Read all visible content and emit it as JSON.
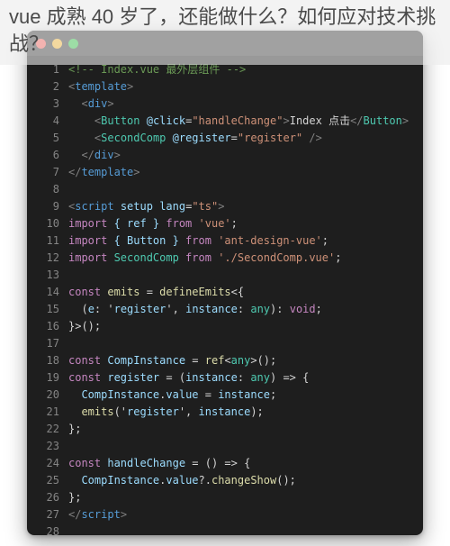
{
  "heading": "vue 成熟 40 岁了，还能做什么？如何应对技术挑战？",
  "editor": {
    "window_buttons": [
      "close",
      "minimize",
      "zoom"
    ],
    "code_lines": [
      {
        "n": 1,
        "kind": "comment",
        "text": "<!-- Index.vue 最外层组件 -->"
      },
      {
        "n": 2,
        "kind": "tag-open",
        "tag": "template"
      },
      {
        "n": 3,
        "kind": "tag-open",
        "tag": "div",
        "indent": 1
      },
      {
        "n": 4,
        "kind": "element",
        "indent": 2,
        "tag": "Button",
        "attr": "@click",
        "attrValue": "handleChange",
        "inner": "Index 点击"
      },
      {
        "n": 5,
        "kind": "element-self",
        "indent": 2,
        "tag": "SecondComp",
        "attr": "@register",
        "attrValue": "register"
      },
      {
        "n": 6,
        "kind": "tag-close",
        "tag": "div",
        "indent": 1
      },
      {
        "n": 7,
        "kind": "tag-close",
        "tag": "template"
      },
      {
        "n": 8,
        "kind": "blank"
      },
      {
        "n": 9,
        "kind": "tag-open-attrs",
        "tag": "script",
        "attrs": [
          [
            "setup",
            ""
          ],
          [
            "lang",
            "ts"
          ]
        ]
      },
      {
        "n": 10,
        "kind": "import",
        "names": "{ ref }",
        "from": "vue"
      },
      {
        "n": 11,
        "kind": "import",
        "names": "{ Button }",
        "from": "ant-design-vue"
      },
      {
        "n": 12,
        "kind": "import-default",
        "name": "SecondComp",
        "from": "./SecondComp.vue"
      },
      {
        "n": 13,
        "kind": "blank"
      },
      {
        "n": 14,
        "kind": "raw",
        "text": "const emits = defineEmits<{"
      },
      {
        "n": 15,
        "kind": "raw",
        "indent": 1,
        "text": "(e: 'register', instance: any): void;"
      },
      {
        "n": 16,
        "kind": "raw",
        "text": "}>();"
      },
      {
        "n": 17,
        "kind": "blank"
      },
      {
        "n": 18,
        "kind": "raw",
        "text": "const CompInstance = ref<any>();"
      },
      {
        "n": 19,
        "kind": "raw",
        "text": "const register = (instance: any) => {"
      },
      {
        "n": 20,
        "kind": "raw",
        "indent": 1,
        "text": "CompInstance.value = instance;"
      },
      {
        "n": 21,
        "kind": "raw",
        "indent": 1,
        "text": "emits('register', instance);"
      },
      {
        "n": 22,
        "kind": "raw",
        "text": "};"
      },
      {
        "n": 23,
        "kind": "blank"
      },
      {
        "n": 24,
        "kind": "raw",
        "text": "const handleChange = () => {"
      },
      {
        "n": 25,
        "kind": "raw",
        "indent": 1,
        "text": "CompInstance.value?.changeShow();"
      },
      {
        "n": 26,
        "kind": "raw",
        "text": "};"
      },
      {
        "n": 27,
        "kind": "tag-close",
        "tag": "script"
      },
      {
        "n": 28,
        "kind": "blank"
      }
    ]
  }
}
